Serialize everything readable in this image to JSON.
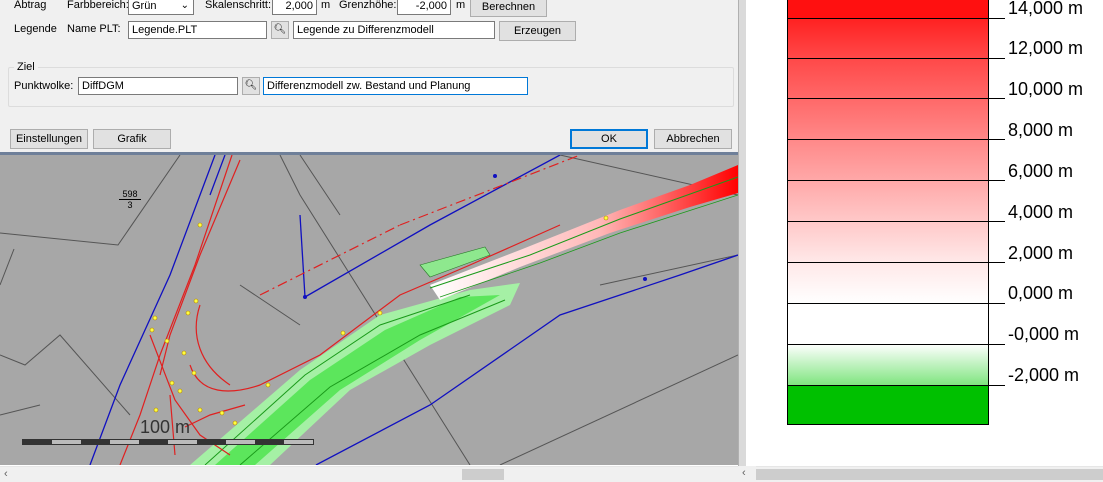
{
  "dialog": {
    "row1": {
      "abtrag_label": "Abtrag",
      "farbbereich_label": "Farbbereich:",
      "farbbereich_value": "Grün",
      "skalenschritt_label": "Skalenschritt:",
      "skalenschritt_value": "2,000",
      "skalenschritt_unit": "m",
      "grenzhoehe_label": "Grenzhöhe:",
      "grenzhoehe_value": "-2,000",
      "grenzhoehe_unit": "m",
      "berechnen_label": "Berechnen"
    },
    "row2": {
      "legende_label": "Legende",
      "name_plt_label": "Name PLT:",
      "name_plt_value": "Legende.PLT",
      "description_value": "Legende zu Differenzmodell",
      "erzeugen_label": "Erzeugen"
    },
    "ziel": {
      "group_label": "Ziel",
      "punktwolke_label": "Punktwolke:",
      "punktwolke_value": "DiffDGM",
      "description_value": "Differenzmodell zw. Bestand und Planung"
    },
    "footer": {
      "einstellungen_label": "Einstellungen",
      "grafik_label": "Grafik",
      "ok_label": "OK",
      "abbrechen_label": "Abbrechen"
    },
    "browse_icon": "magnifier-icon"
  },
  "map": {
    "parcel_number": "598",
    "parcel_sub": "3",
    "scale_label": "100 m"
  },
  "legend": {
    "labels": [
      "14,000 m",
      "12,000 m",
      "10,000 m",
      "8,000 m",
      "6,000 m",
      "4,000 m",
      "2,000 m",
      "0,000 m",
      "-0,000 m",
      "-2,000 m"
    ],
    "colors": {
      "red": "#ff0000",
      "white": "#ffffff",
      "green_light": "#7fe57f",
      "green": "#00c000"
    }
  },
  "scrollbars": {
    "left_arrow": "‹",
    "right_arrow": "›"
  }
}
